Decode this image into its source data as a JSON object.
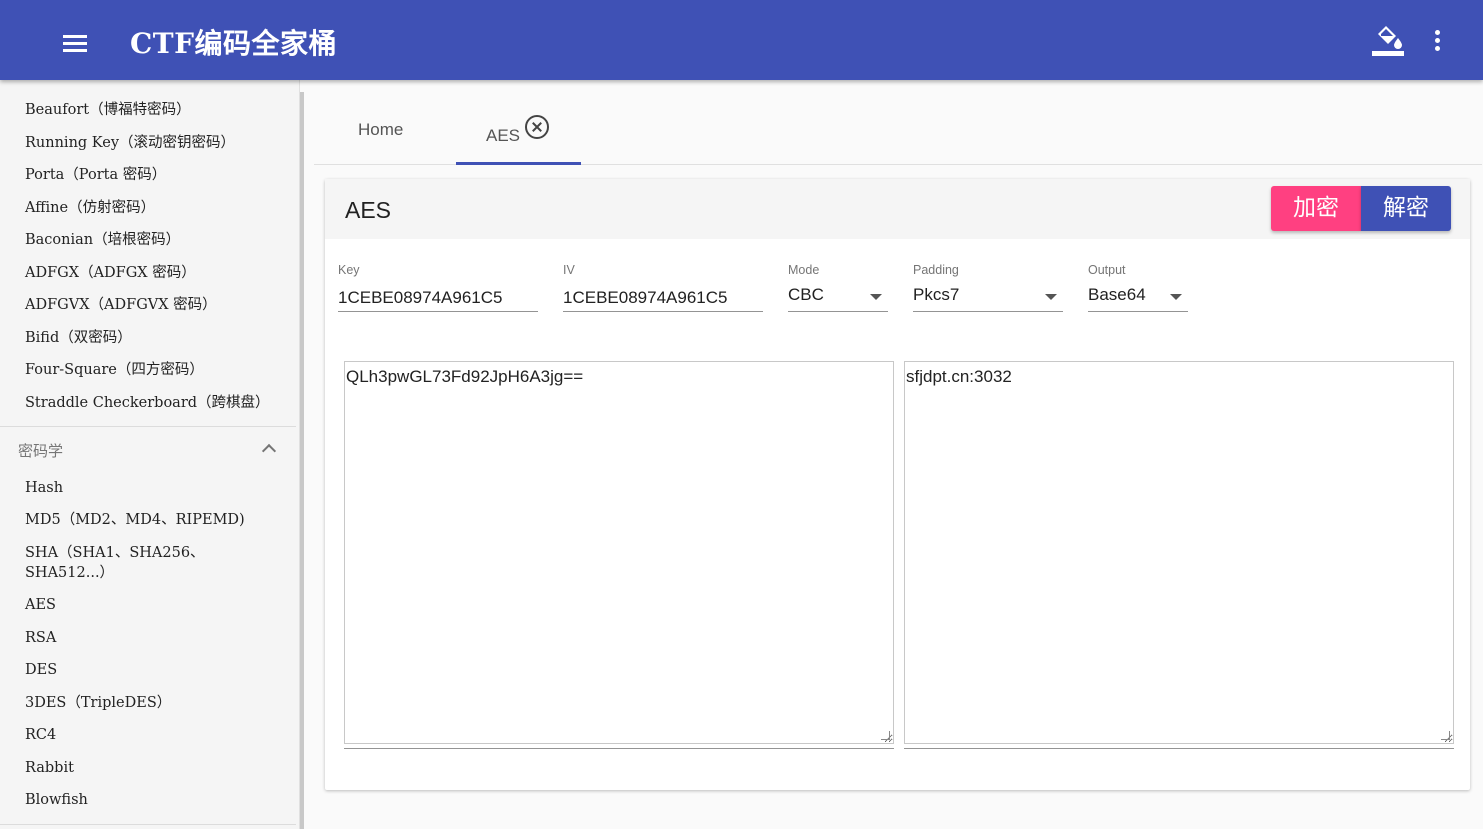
{
  "app": {
    "title": "CTF编码全家桶"
  },
  "icons": {
    "menu": "menu-icon",
    "theme": "format-color-fill-icon",
    "more": "more-vert-icon",
    "tab_close": "close-circle-icon",
    "section_toggle": "chevron-up-icon"
  },
  "colors": {
    "primary": "#3f51b5",
    "accent": "#ff4081"
  },
  "sidebar": {
    "classical_items": [
      "Beaufort（博福特密码）",
      "Running Key（滚动密钥密码）",
      "Porta（Porta 密码）",
      "Affine（仿射密码）",
      "Baconian（培根密码）",
      "ADFGX（ADFGX 密码）",
      "ADFGVX（ADFGVX 密码）",
      "Bifid（双密码）",
      "Four-Square（四方密码）",
      "Straddle Checkerboard（跨棋盘）"
    ],
    "crypto_section": {
      "label": "密码学",
      "items": [
        "Hash",
        "MD5（MD2、MD4、RIPEMD)",
        "SHA（SHA1、SHA256、SHA512...）",
        "AES",
        "RSA",
        "DES",
        "3DES（TripleDES）",
        "RC4",
        "Rabbit",
        "Blowfish"
      ]
    }
  },
  "tabs": [
    {
      "label": "Home"
    },
    {
      "label": "AES",
      "active": true
    }
  ],
  "card": {
    "title": "AES",
    "encrypt_label": "加密",
    "decrypt_label": "解密",
    "fields": {
      "key": {
        "label": "Key",
        "value": "1CEBE08974A961C5"
      },
      "iv": {
        "label": "IV",
        "value": "1CEBE08974A961C5"
      },
      "mode": {
        "label": "Mode",
        "value": "CBC"
      },
      "padding": {
        "label": "Padding",
        "value": "Pkcs7"
      },
      "output": {
        "label": "Output",
        "value": "Base64"
      }
    },
    "input_text": "QLh3pwGL73Fd92JpH6A3jg==",
    "output_text": "sfjdpt.cn:3032"
  }
}
